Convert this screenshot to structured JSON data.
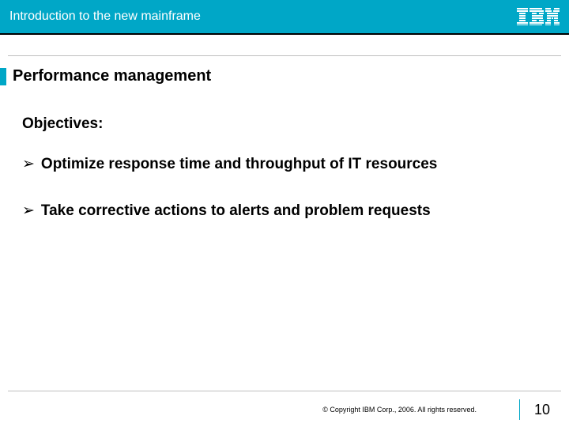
{
  "header": {
    "title": "Introduction to the new mainframe",
    "logo_name": "ibm-logo"
  },
  "slide": {
    "title": "Performance management",
    "objectives_label": "Objectives:",
    "bullets": [
      "Optimize response time and throughput of IT resources",
      "Take corrective actions to alerts and problem requests"
    ]
  },
  "footer": {
    "copyright": "© Copyright IBM Corp., 2006. All rights reserved.",
    "page": "10"
  }
}
